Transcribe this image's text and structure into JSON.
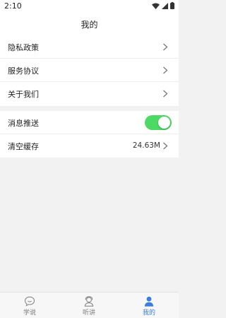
{
  "status_bar": {
    "time": "2:10"
  },
  "header": {
    "title": "我的"
  },
  "settings_group_1": [
    {
      "label": "隐私政策"
    },
    {
      "label": "服务协议"
    },
    {
      "label": "关于我们"
    }
  ],
  "settings_group_2": {
    "push": {
      "label": "消息推送",
      "enabled": true
    },
    "cache": {
      "label": "清空缓存",
      "value": "24.63M"
    }
  },
  "tabs": [
    {
      "label": "学说",
      "icon": "chat-bubble-icon",
      "active": false
    },
    {
      "label": "听讲",
      "icon": "listener-icon",
      "active": false
    },
    {
      "label": "我的",
      "icon": "person-icon",
      "active": true
    }
  ],
  "colors": {
    "accent": "#3b7ddd",
    "toggle_on": "#4cd964"
  }
}
